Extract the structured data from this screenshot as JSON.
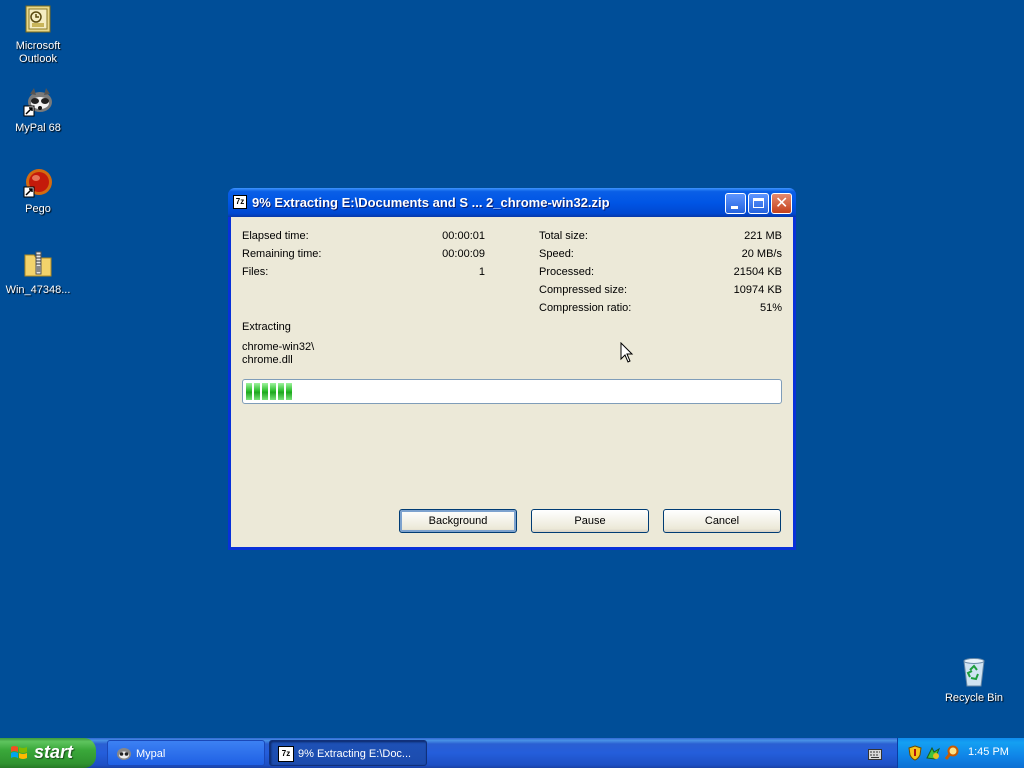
{
  "desktop": {
    "icons": [
      {
        "label": "Microsoft Outlook",
        "icon": "outlook-icon"
      },
      {
        "label": "MyPal 68",
        "icon": "mypal-icon"
      },
      {
        "label": "Pego",
        "icon": "pego-icon"
      },
      {
        "label": "Win_47348...",
        "icon": "zip-folder-icon"
      },
      {
        "label": "Recycle Bin",
        "icon": "recycle-bin-icon"
      }
    ]
  },
  "window": {
    "app_icon_text": "7z",
    "title": "9% Extracting E:\\Documents and S ... 2_chrome-win32.zip",
    "stats_left": [
      {
        "label": "Elapsed time:",
        "value": "00:00:01"
      },
      {
        "label": "Remaining time:",
        "value": "00:00:09"
      },
      {
        "label": "Files:",
        "value": "1"
      }
    ],
    "stats_right": [
      {
        "label": "Total size:",
        "value": "221 MB"
      },
      {
        "label": "Speed:",
        "value": "20 MB/s"
      },
      {
        "label": "Processed:",
        "value": "21504 KB"
      },
      {
        "label": "Compressed size:",
        "value": "10974 KB"
      },
      {
        "label": "Compression ratio:",
        "value": "51%"
      }
    ],
    "status_label": "Extracting",
    "current_path": "chrome-win32\\",
    "current_file": "chrome.dll",
    "progress_percent": 9,
    "buttons": {
      "background": "Background",
      "pause": "Pause",
      "cancel": "Cancel"
    }
  },
  "taskbar": {
    "start_label": "start",
    "items": [
      {
        "label": "Mypal",
        "active": false
      },
      {
        "label": "9% Extracting E:\\Doc...",
        "active": true
      }
    ],
    "clock": "1:45 PM"
  },
  "colors": {
    "desktop_bg": "#004e98",
    "titlebar": "#0055e5",
    "progress_fill": "#2fbf2f"
  }
}
